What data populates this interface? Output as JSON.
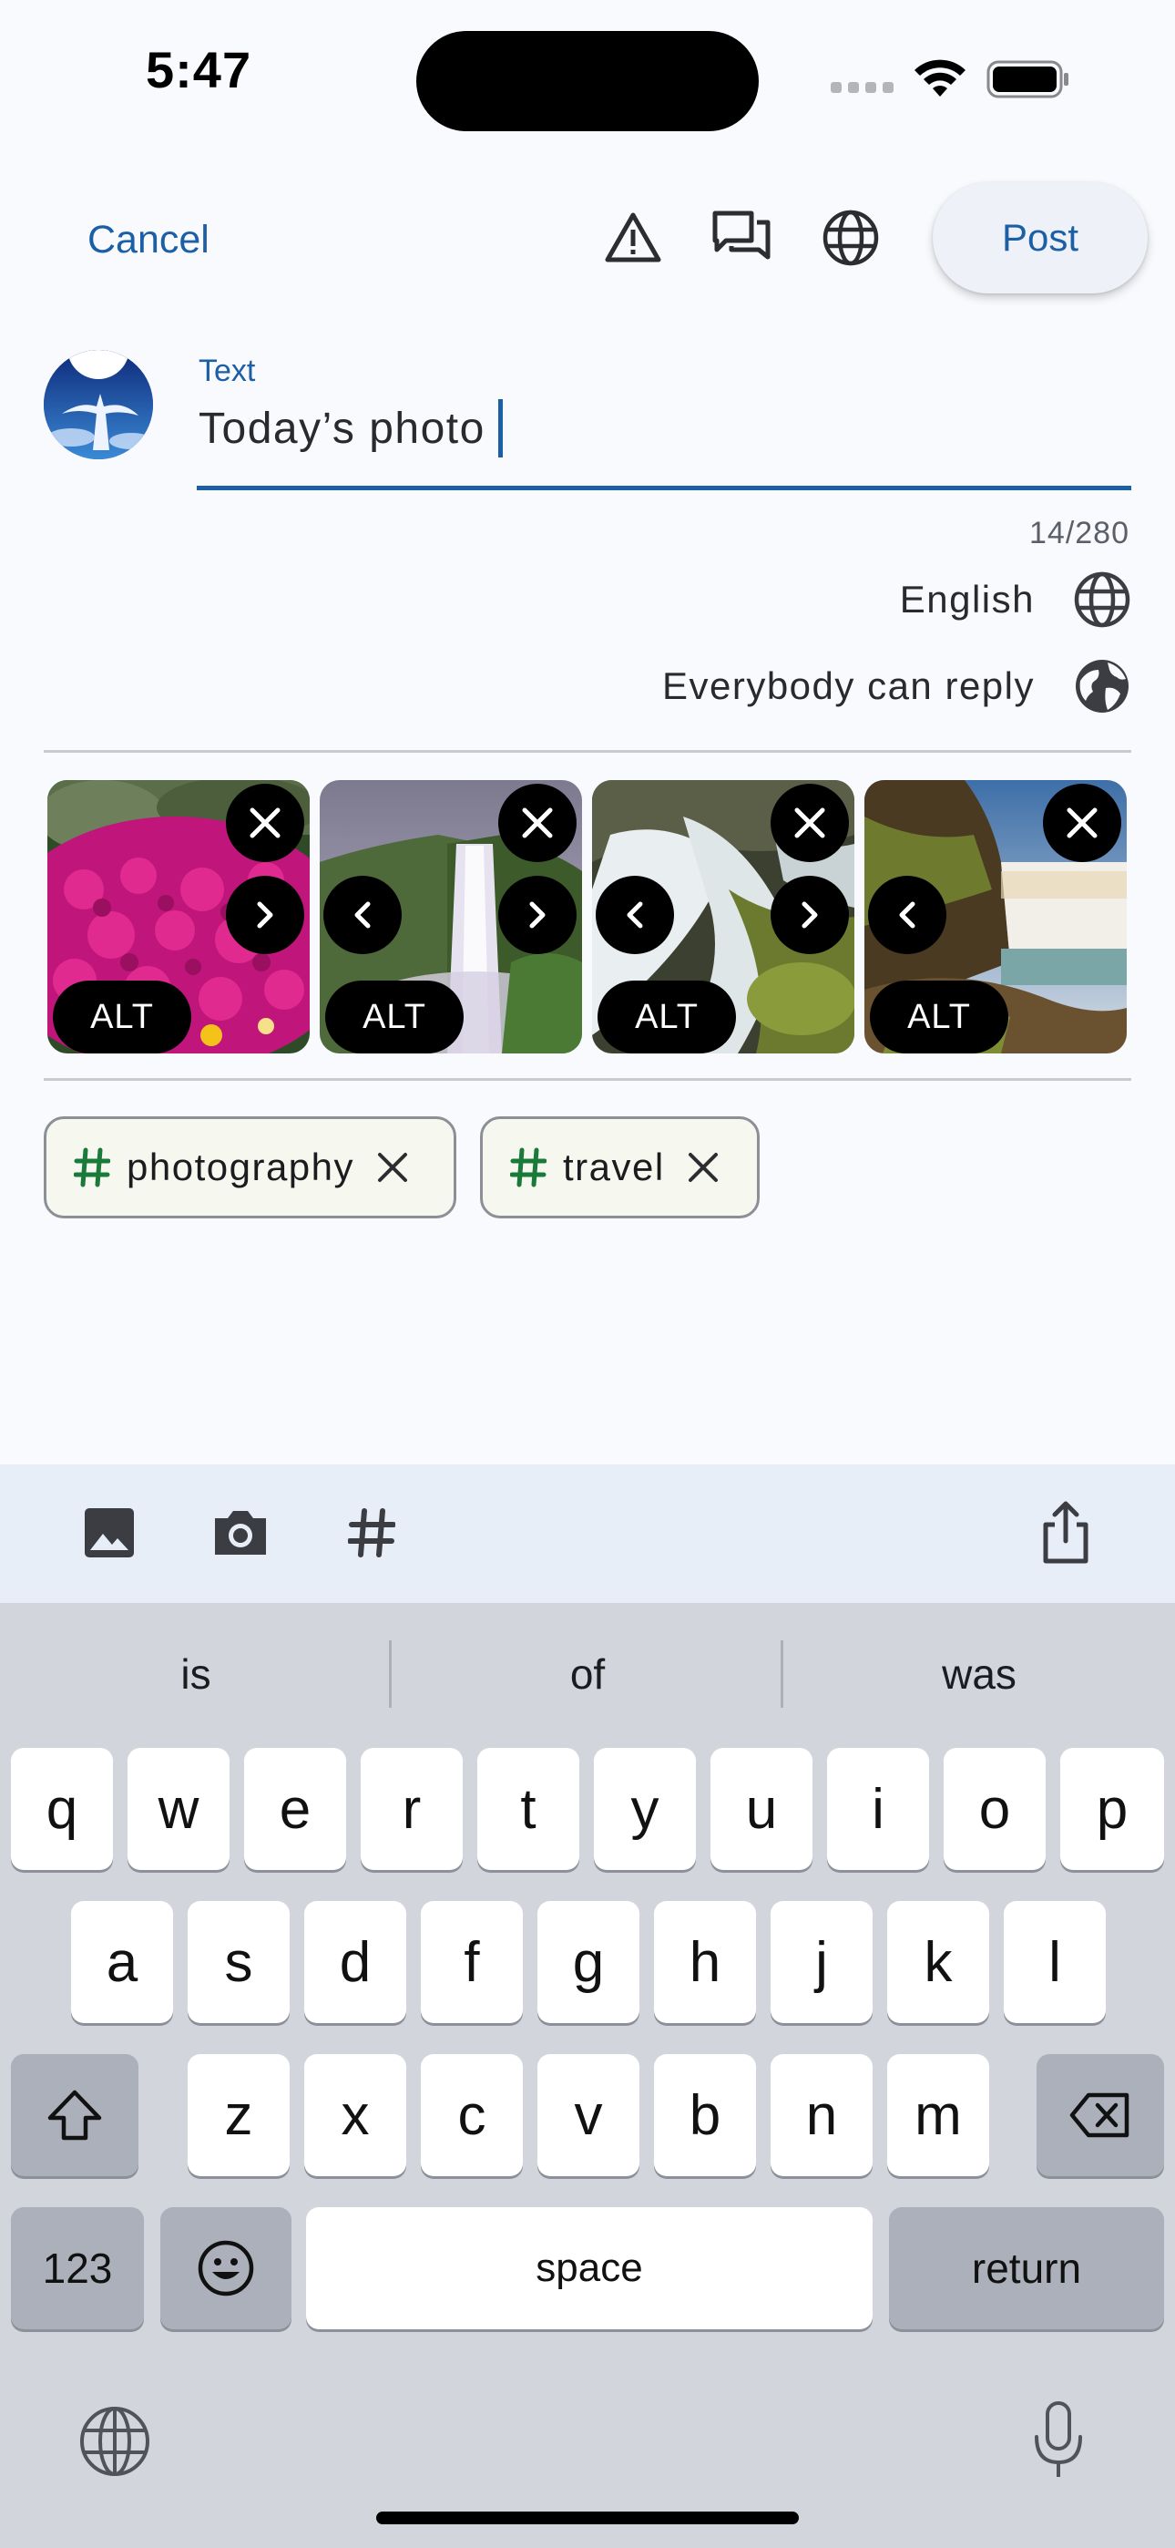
{
  "status": {
    "time": "5:47"
  },
  "toolbar_top": {
    "cancel_label": "Cancel",
    "post_label": "Post",
    "icons": [
      "warning-icon",
      "conversation-icon",
      "globe-icon"
    ]
  },
  "compose": {
    "field_label": "Text",
    "text_value": "Today’s photo",
    "counter": "14/280",
    "language": "English",
    "reply_setting": "Everybody can reply"
  },
  "media": {
    "alt_label": "ALT",
    "items": [
      {
        "name": "flowers-photo",
        "scene": "pink flowers"
      },
      {
        "name": "waterfall-photo-1",
        "scene": "waterfall in mist"
      },
      {
        "name": "waterfall-photo-2",
        "scene": "long exposure waterfall"
      },
      {
        "name": "waterfall-photo-3",
        "scene": "waterfall at sunset"
      }
    ]
  },
  "tags": [
    {
      "label": "photography"
    },
    {
      "label": "travel"
    }
  ],
  "composer_tools": [
    "image-icon",
    "camera-icon",
    "hashtag-icon",
    "share-icon"
  ],
  "keyboard": {
    "suggestions": [
      "is",
      "of",
      "was"
    ],
    "row1": [
      "q",
      "w",
      "e",
      "r",
      "t",
      "y",
      "u",
      "i",
      "o",
      "p"
    ],
    "row2": [
      "a",
      "s",
      "d",
      "f",
      "g",
      "h",
      "j",
      "k",
      "l"
    ],
    "row3": [
      "z",
      "x",
      "c",
      "v",
      "b",
      "n",
      "m"
    ],
    "numbers_label": "123",
    "space_label": "space",
    "return_label": "return"
  },
  "colors": {
    "accent": "#1c5fa5",
    "hashtag": "#1a7a3a",
    "background": "#f9fafd",
    "keyboard": "#d2d5dc"
  }
}
